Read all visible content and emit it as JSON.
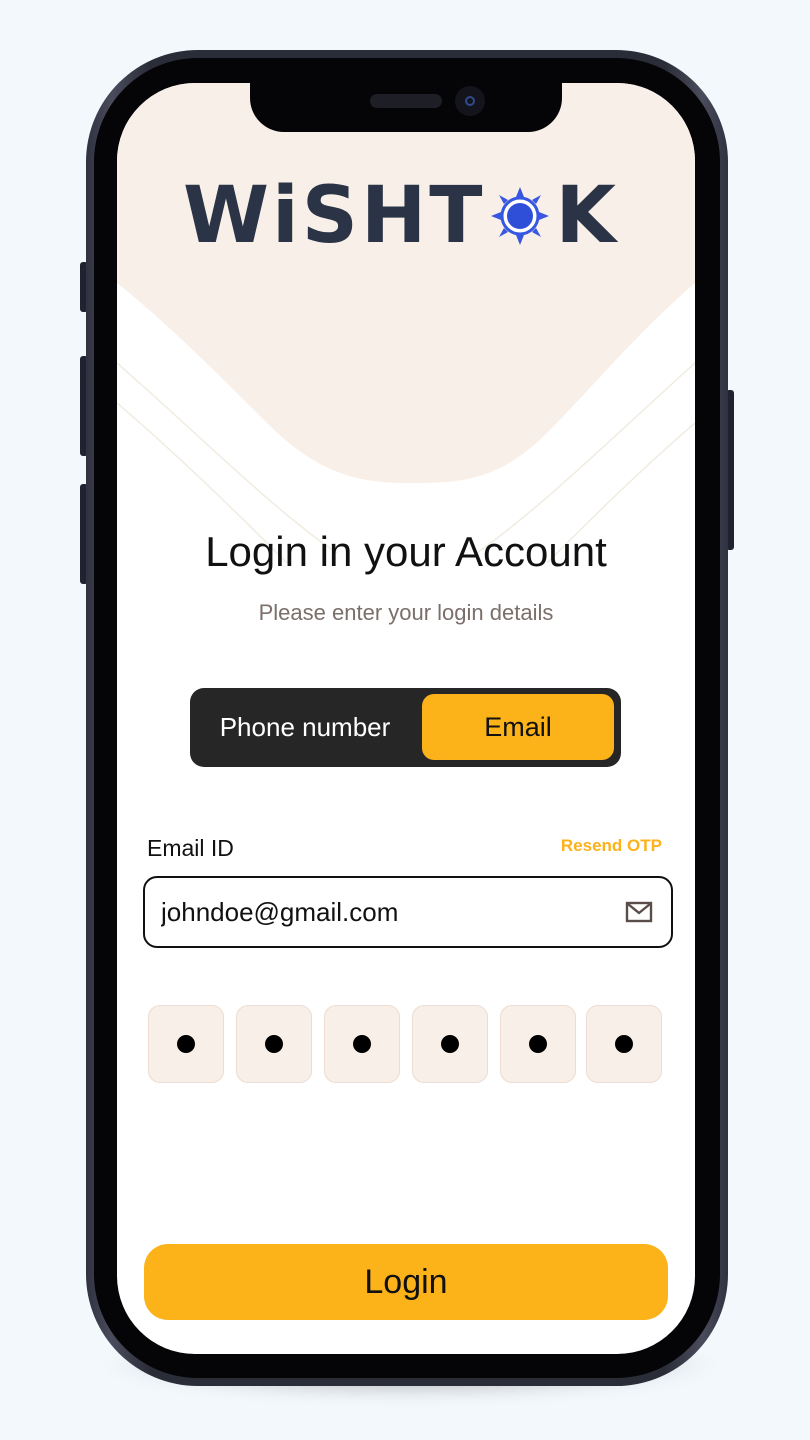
{
  "brand": {
    "logo_left": "WiSHT",
    "logo_right": "K",
    "logo_text": "WiSHTOK",
    "logo_color": "#2b3446",
    "sun_color": "#3857e0"
  },
  "login": {
    "title": "Login in your Account",
    "subtitle": "Please enter your login details"
  },
  "method_toggle": {
    "options": [
      "Phone number",
      "Email"
    ],
    "selected": "Email"
  },
  "email_field": {
    "label": "Email ID",
    "value": "johndoe@gmail.com",
    "icon": "mail-icon"
  },
  "resend_otp": "Resend OTP",
  "otp": {
    "digits_entered": 6,
    "masked": true
  },
  "login_button": "Login",
  "colors": {
    "accent": "#fcb219",
    "toggle_bg": "#262626",
    "hero_bg": "#f9efe9",
    "otp_bg": "#f9efe9"
  }
}
